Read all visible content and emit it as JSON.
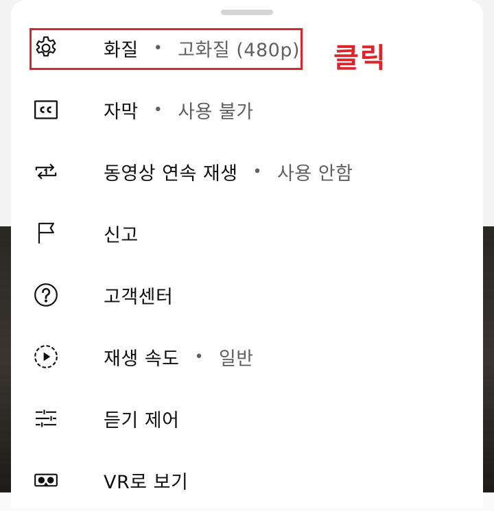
{
  "menu": {
    "items": [
      {
        "name": "quality",
        "icon": "gear-icon",
        "label": "화질",
        "value": "고화질 (480p)"
      },
      {
        "name": "captions",
        "icon": "cc-icon",
        "label": "자막",
        "value": "사용 불가"
      },
      {
        "name": "autoplay",
        "icon": "repeat-one-icon",
        "label": "동영상 연속 재생",
        "value": "사용 안함"
      },
      {
        "name": "report",
        "icon": "flag-icon",
        "label": "신고"
      },
      {
        "name": "help",
        "icon": "help-circle-icon",
        "label": "고객센터"
      },
      {
        "name": "playback-speed",
        "icon": "playback-speed-icon",
        "label": "재생 속도",
        "value": "일반"
      },
      {
        "name": "listening-controls",
        "icon": "sliders-icon",
        "label": "듣기 제어"
      },
      {
        "name": "vr-view",
        "icon": "vr-headset-icon",
        "label": "VR로 보기"
      }
    ],
    "separator": "•"
  },
  "annotation": {
    "text": "클릭",
    "color": "#d9252c"
  },
  "colors": {
    "primary_text": "#0f0f0f",
    "secondary_text": "#606060",
    "sheet_bg": "#ffffff"
  }
}
